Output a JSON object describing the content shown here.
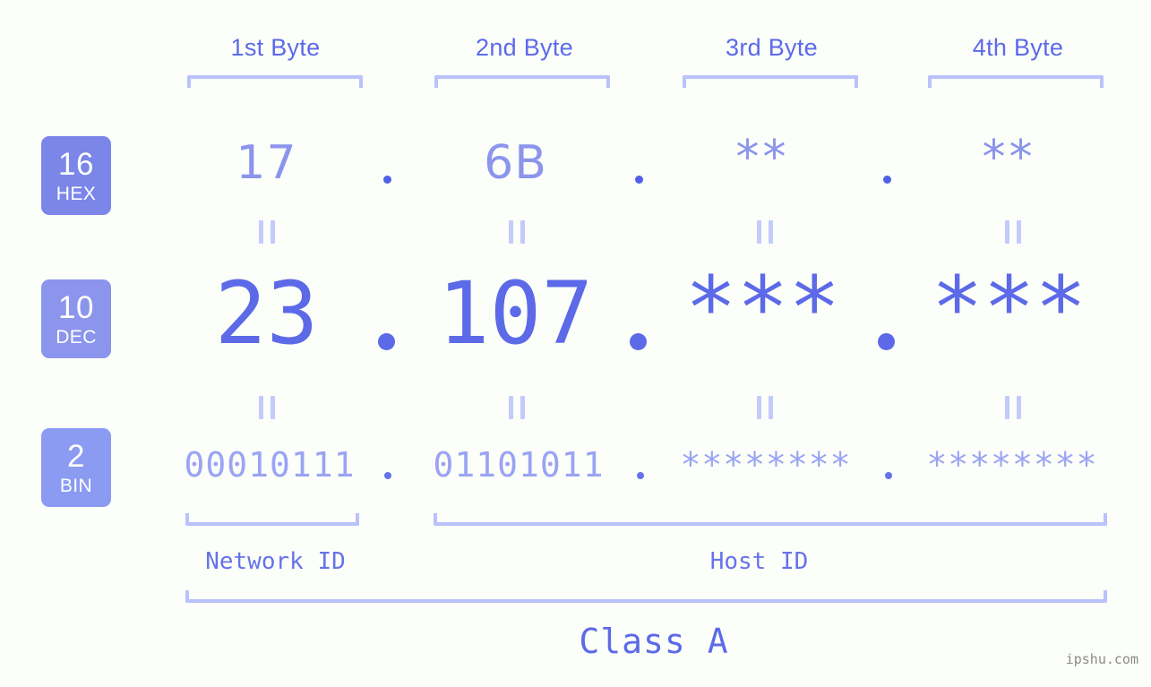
{
  "theme": {
    "background": "#fcfefa",
    "accent_strong": "#5c6ae8",
    "accent_mid": "#8b95ec",
    "accent_light": "#b9c2fb",
    "badge_hex": "#7b86e8",
    "badge_dec": "#8b95ec",
    "badge_bin": "#8b9bf2",
    "watermark_color": "#8a8a8a"
  },
  "byte_headers": [
    {
      "label": "1st Byte"
    },
    {
      "label": "2nd Byte"
    },
    {
      "label": "3rd Byte"
    },
    {
      "label": "4th Byte"
    }
  ],
  "bases": [
    {
      "num": "16",
      "name": "HEX"
    },
    {
      "num": "10",
      "name": "DEC"
    },
    {
      "num": "2",
      "name": "BIN"
    }
  ],
  "rows": {
    "hex": {
      "values": [
        "17",
        "6B",
        "**",
        "**"
      ],
      "separator": "."
    },
    "dec": {
      "values": [
        "23",
        "107",
        "***",
        "***"
      ],
      "separator": "."
    },
    "bin": {
      "values": [
        "00010111",
        "01101011",
        "********",
        "********"
      ],
      "separator": "."
    }
  },
  "id_labels": {
    "network": "Network ID",
    "host": "Host ID"
  },
  "class_label": "Class A",
  "watermark": "ipshu.com"
}
